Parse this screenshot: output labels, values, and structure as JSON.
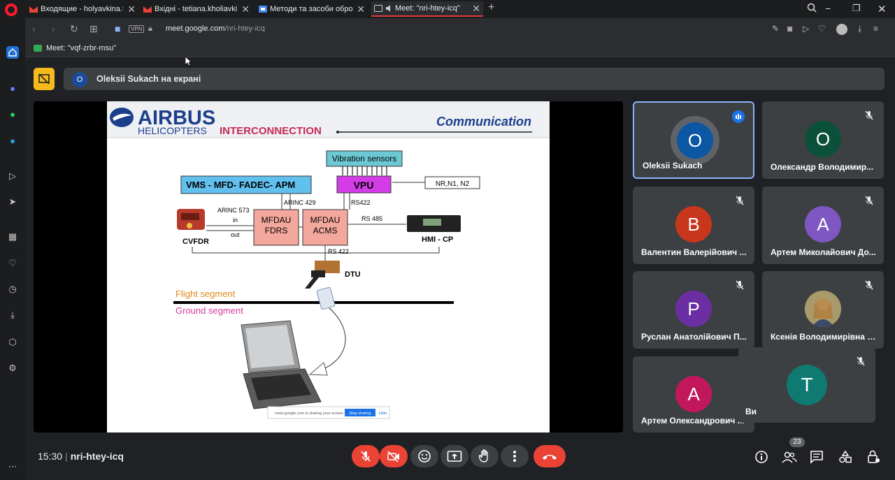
{
  "browser": {
    "tabs": [
      {
        "title": "Входящие - holyavkina.t@",
        "favicon": "gmail-icon",
        "active": false
      },
      {
        "title": "Вхідні - tetiana.kholiavkina",
        "favicon": "gmail-icon",
        "active": false
      },
      {
        "title": "Методи та засоби обробк",
        "favicon": "classroom-icon",
        "active": false
      },
      {
        "title": "Meet: \"nri-htey-icq\"",
        "favicon": "meet-icon",
        "active": true
      }
    ],
    "new_tab": "+",
    "vpn": "VPN",
    "url_domain": "meet.google.com",
    "url_path": "/nri-htey-icq",
    "bookmark": "Meet: \"vqf-zrbr-msu\""
  },
  "meet": {
    "presenter_initial": "O",
    "presenter_banner": "Oleksii Sukach на екрані",
    "time": "15:30",
    "meeting_code": "nri-htey-icq",
    "participant_count": "23",
    "participants": [
      {
        "name": "Oleksii Sukach",
        "initial": "O",
        "color": "#0b57a3",
        "speaking": true,
        "muted": false
      },
      {
        "name": "Олександр Володимир...",
        "initial": "О",
        "color": "#0b5139",
        "speaking": false,
        "muted": true
      },
      {
        "name": "Валентин Валерійович ...",
        "initial": "В",
        "color": "#c8361c",
        "speaking": false,
        "muted": true
      },
      {
        "name": "Артем Миколайович До...",
        "initial": "А",
        "color": "#7e57c2",
        "speaking": false,
        "muted": true
      },
      {
        "name": "Руслан Анатолійович П...",
        "initial": "Р",
        "color": "#6b2fa3",
        "speaking": false,
        "muted": true
      },
      {
        "name": "Ксенія Володимирівна К...",
        "initial": "",
        "color": "#7a6a4a",
        "speaking": false,
        "muted": true
      },
      {
        "name": "Артем Олександрович ...",
        "initial": "А",
        "color": "#c2185b",
        "speaking": false,
        "muted": true
      }
    ],
    "self_tile": {
      "name": "Ви",
      "initial": "T",
      "color": "#0f7a72"
    }
  },
  "slide": {
    "logo_top": "AIRBUS",
    "logo_bottom": "HELICOPTERS",
    "title": "INTERCONNECTION",
    "subtitle": "Communication",
    "vibration": "Vibration sensors",
    "vms": "VMS - MFD-  FADEC- APM",
    "vpu": "VPU",
    "nr": "NR,N1, N2",
    "arinc573": "ARINC 573",
    "in": "in",
    "out": "out",
    "arinc429": "ARINC 429",
    "rs422a": "RS422",
    "mfdau1_l1": "MFDAU",
    "mfdau1_l2": "FDRS",
    "mfdau2_l1": "MFDAU",
    "mfdau2_l2": "ACMS",
    "rs485": "RS 485",
    "cvfdr": "CVFDR",
    "hmi": "HMI - CP",
    "rs422b": "RS 422",
    "dtu": "DTU",
    "flight": "Flight segment",
    "ground": "Ground segment",
    "share_msg": "meet.google.com is sharing your screen.",
    "stop_sharing": "Stop sharing",
    "hide": "Hide"
  }
}
